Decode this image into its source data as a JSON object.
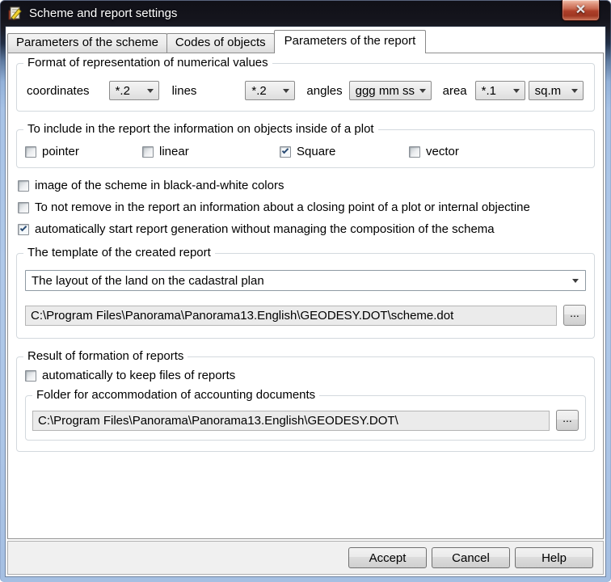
{
  "window": {
    "title": "Scheme and report settings",
    "icons": {
      "close": "✕",
      "combo_arrow": "▾",
      "check": "✓"
    }
  },
  "tabs": [
    {
      "label": "Parameters of the scheme",
      "active": false
    },
    {
      "label": "Codes of objects",
      "active": false
    },
    {
      "label": "Parameters of the report",
      "active": true
    }
  ],
  "format_group": {
    "title": "Format of representation of numerical values",
    "coordinates_label": "coordinates",
    "coordinates_value": "*.2",
    "lines_label": "lines",
    "lines_value": "*.2",
    "angles_label": "angles",
    "angles_value": "ggg mm ss",
    "area_label": "area",
    "area_value": "*.1",
    "area_unit_value": "sq.m"
  },
  "include_group": {
    "title": "To include in the report the information on objects inside of a plot",
    "checkboxes": [
      {
        "label": "pointer",
        "checked": false
      },
      {
        "label": "linear",
        "checked": false
      },
      {
        "label": "Square",
        "checked": true
      },
      {
        "label": "vector",
        "checked": false
      }
    ]
  },
  "options": [
    {
      "label": "image of the scheme in black-and-white colors",
      "checked": false
    },
    {
      "label": "To not remove in the report an information about a closing point of a plot or internal objectine",
      "checked": false
    },
    {
      "label": "automatically start report generation without managing the composition of the schema",
      "checked": true
    }
  ],
  "template_group": {
    "title": "The template of the created report",
    "selected_template": "The layout of the land on the cadastral plan",
    "template_path": "C:\\Program Files\\Panorama\\Panorama13.English\\GEODESY.DOT\\scheme.dot",
    "browse_label": "..."
  },
  "result_group": {
    "title": "Result of formation of reports",
    "keep_files": {
      "label": "automatically to keep files of reports",
      "checked": false
    },
    "folder_group": {
      "title": "Folder for accommodation of accounting documents",
      "path": "C:\\Program Files\\Panorama\\Panorama13.English\\GEODESY.DOT\\",
      "browse_label": "..."
    }
  },
  "footer": {
    "accept": "Accept",
    "cancel": "Cancel",
    "help": "Help"
  }
}
